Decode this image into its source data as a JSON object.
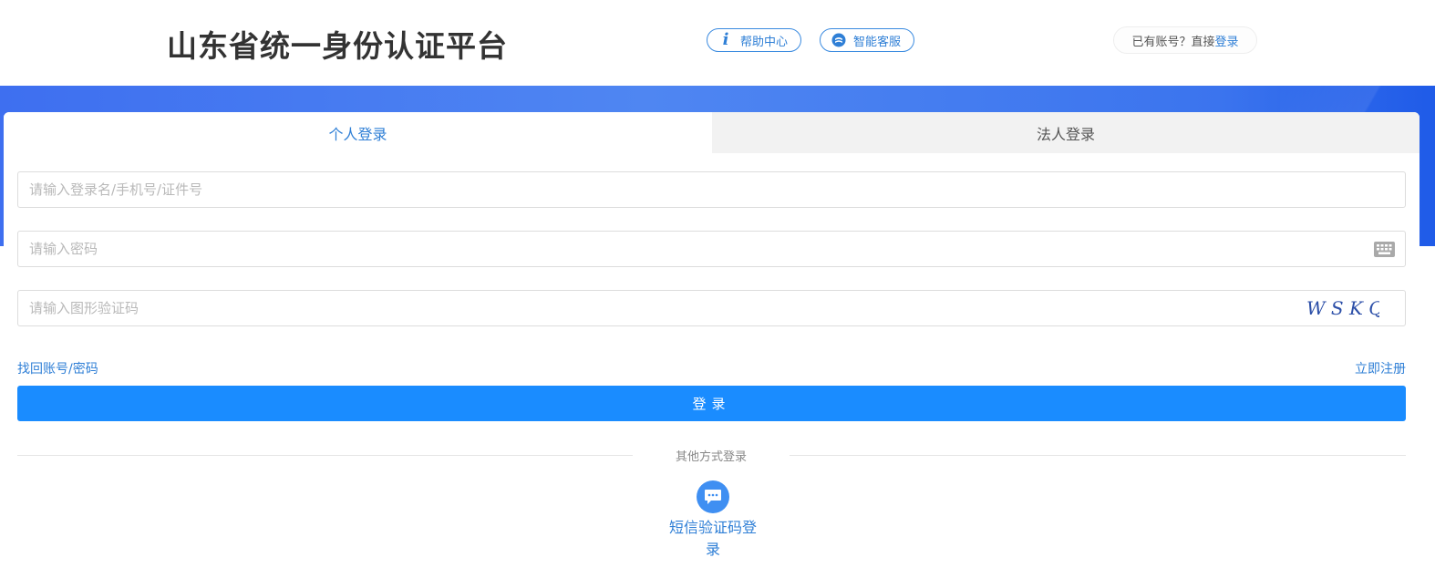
{
  "header": {
    "title": "山东省统一身份认证平台",
    "help_label": "帮助中心",
    "service_label": "智能客服",
    "account_prompt": "已有账号？直接",
    "account_login_link": "登录"
  },
  "tabs": [
    {
      "label": "个人登录",
      "active": true
    },
    {
      "label": "法人登录",
      "active": false
    }
  ],
  "form": {
    "username_placeholder": "请输入登录名/手机号/证件号",
    "password_placeholder": "请输入密码",
    "captcha_placeholder": "请输入图形验证码",
    "captcha_text": "W S K Q",
    "find_account_link": "找回账号/密码",
    "register_link": "立即注册",
    "login_button": "登录"
  },
  "other_login": {
    "divider_text": "其他方式登录",
    "sms_label": "短信验证码登录"
  },
  "icons": {
    "help": "info-icon",
    "service": "customer-service-icon",
    "password_keyboard": "keyboard-icon",
    "sms": "chat-bubble-icon"
  },
  "colors": {
    "accent": "#2f7fd6",
    "primary_button": "#1a8cff",
    "banner": "#3e6ff0"
  }
}
